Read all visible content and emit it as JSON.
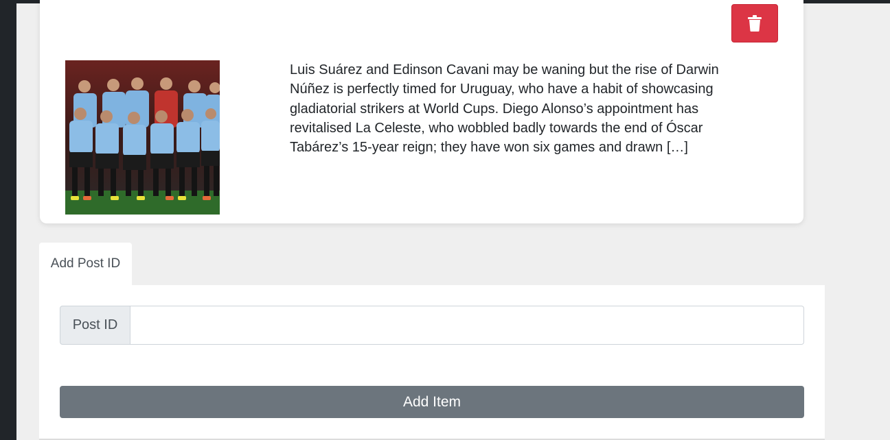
{
  "post": {
    "delete_icon": "trash-icon",
    "image_alt": "Uruguay national team photo",
    "text": "Luis Suárez and Edinson Cavani may be waning but the rise of Darwin Núñez is perfectly timed for Uruguay, who have a habit of showcasing gladiatorial strikers at World Cups. Diego Alonso’s appointment has revitalised La Celeste, who wobbled badly towards the end of Óscar Tabárez’s 15-year reign; they have won six games and drawn […]"
  },
  "tab": {
    "label": "Add Post ID"
  },
  "form": {
    "post_id_label": "Post ID",
    "post_id_value": "",
    "submit_label": "Add Item"
  },
  "colors": {
    "danger": "#dc3545",
    "secondary": "#6c757d",
    "background": "#efefef",
    "dark": "#212529"
  }
}
